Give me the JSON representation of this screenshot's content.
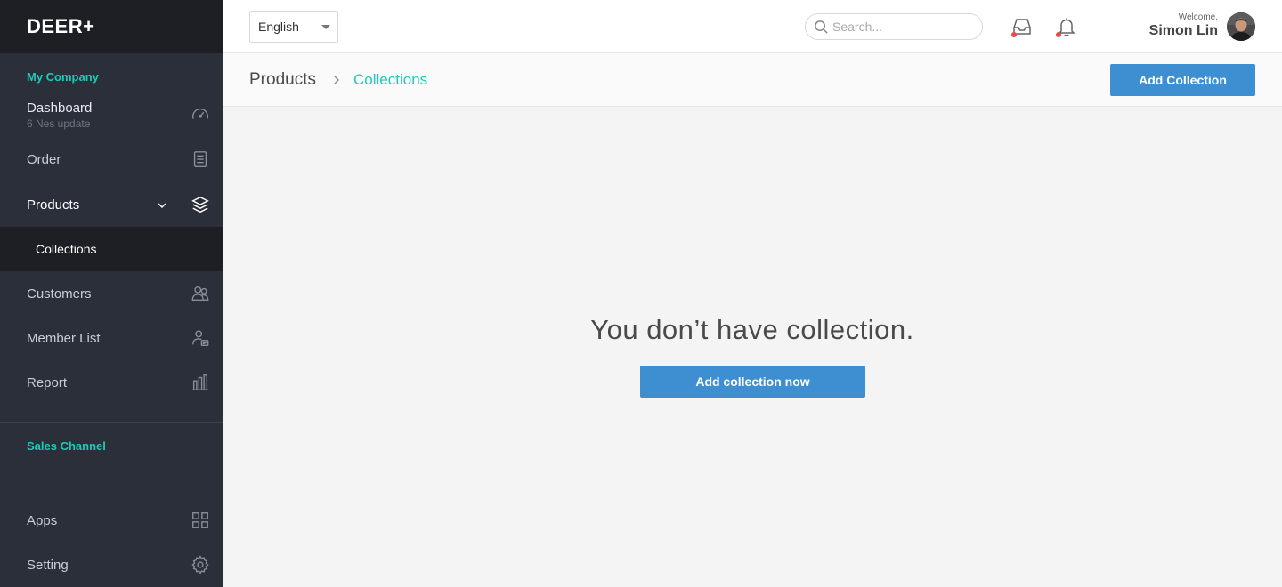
{
  "brand": {
    "logo": "DEER+"
  },
  "sidebar": {
    "section_company": "My Company",
    "dashboard": {
      "label": "Dashboard",
      "sub": "6 Nes update",
      "icon": "speedometer-icon"
    },
    "order": {
      "label": "Order",
      "icon": "document-list-icon"
    },
    "products": {
      "label": "Products",
      "icon": "boxes-icon"
    },
    "collections": {
      "label": "Collections"
    },
    "customers": {
      "label": "Customers",
      "icon": "users-icon"
    },
    "member_list": {
      "label": "Member List",
      "icon": "member-card-icon"
    },
    "report": {
      "label": "Report",
      "icon": "bar-chart-icon"
    },
    "section_sales": "Sales Channel",
    "apps": {
      "label": "Apps",
      "icon": "grid-icon"
    },
    "setting": {
      "label": "Setting",
      "icon": "gear-icon"
    }
  },
  "topbar": {
    "language": "English",
    "search_placeholder": "Search...",
    "welcome": "Welcome,",
    "username": "Simon Lin"
  },
  "header": {
    "breadcrumb_parent": "Products",
    "breadcrumb_current": "Collections",
    "add_button": "Add Collection"
  },
  "main": {
    "empty_message": "You don’t have collection.",
    "cta_button": "Add collection now"
  },
  "colors": {
    "accent_teal": "#1ecab8",
    "primary_blue": "#3d8fd1",
    "sidebar_bg": "#2b2f3a",
    "notification_dot": "#e84a4a"
  }
}
